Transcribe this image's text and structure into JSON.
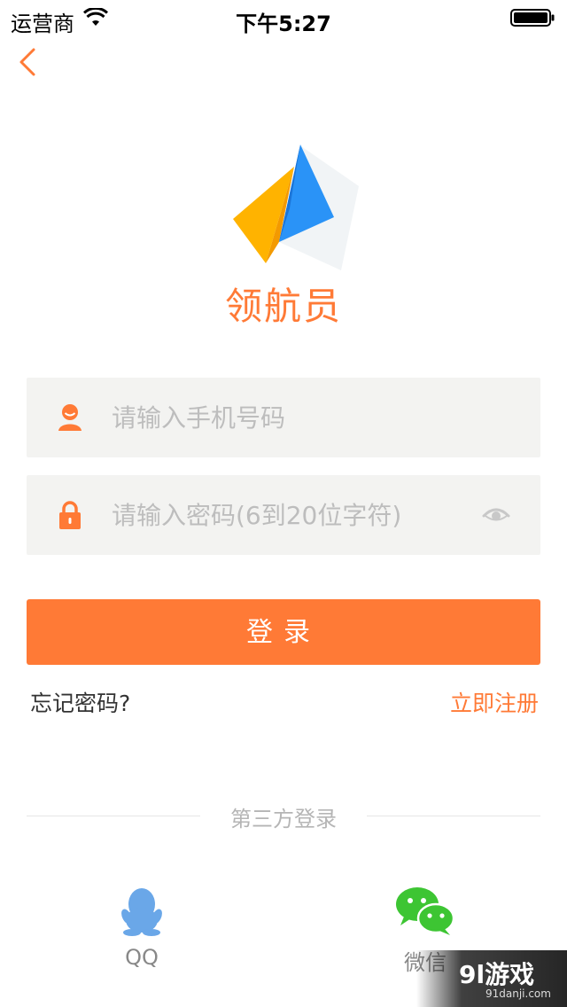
{
  "status_bar": {
    "carrier": "运营商",
    "time": "下午5:27"
  },
  "app": {
    "name": "领航员"
  },
  "phone_field": {
    "placeholder": "请输入手机号码",
    "value": ""
  },
  "password_field": {
    "placeholder": "请输入密码(6到20位字符)",
    "value": ""
  },
  "login_button": {
    "label": "登录"
  },
  "links": {
    "forgot_password": "忘记密码?",
    "register": "立即注册"
  },
  "third_party": {
    "title": "第三方登录",
    "qq_label": "QQ",
    "wechat_label": "微信"
  },
  "watermark": {
    "main": "9l游戏",
    "sub": "91danji.com"
  },
  "colors": {
    "accent": "#ff7a36",
    "field_bg": "#f3f3f1",
    "qq_blue": "#6aa7e8",
    "wechat_green": "#3dc533"
  }
}
